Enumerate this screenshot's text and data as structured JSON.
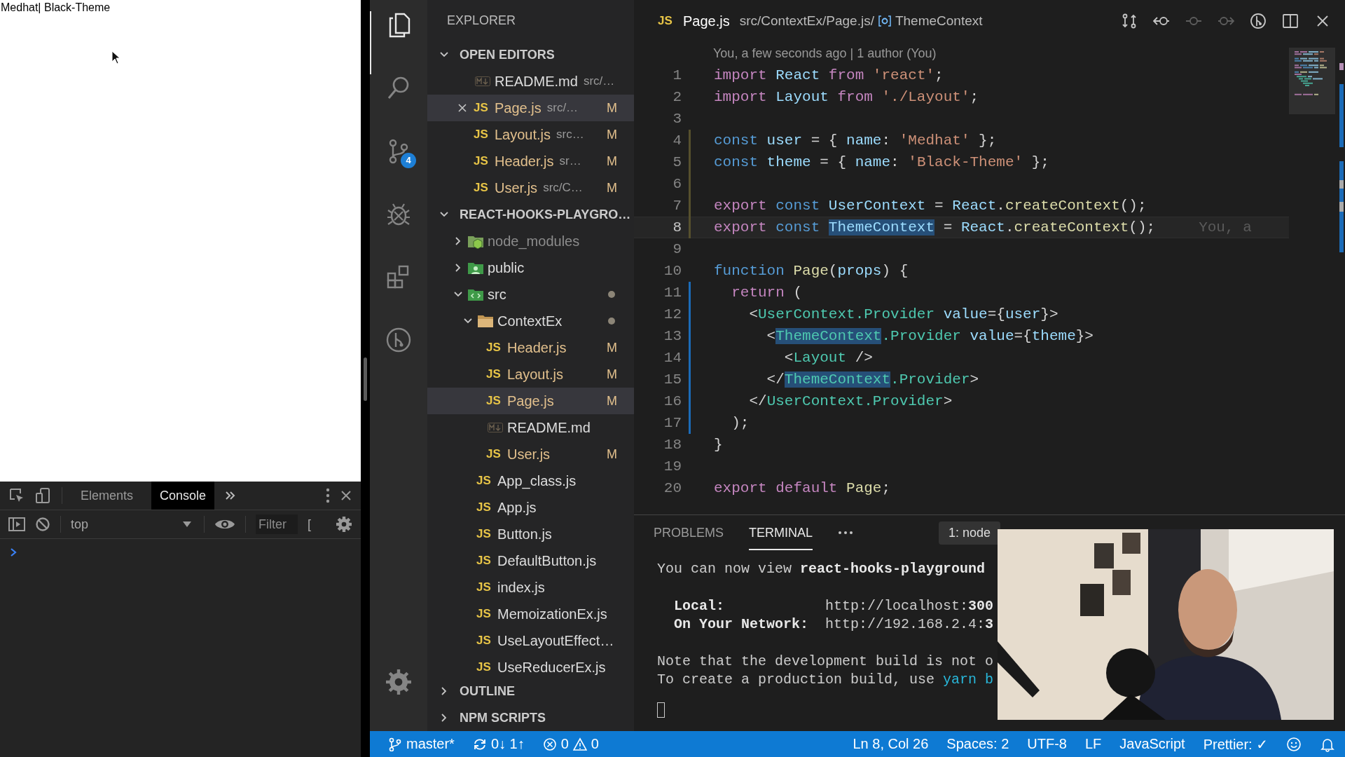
{
  "browser_page": {
    "text": "Medhat| Black-Theme"
  },
  "devtools": {
    "tabs": [
      {
        "label": "Elements",
        "selected": false
      },
      {
        "label": "Console",
        "selected": true
      }
    ],
    "context": "top",
    "filter": {
      "placeholder": "Filter"
    },
    "levels": "["
  },
  "activity_bar": [
    {
      "kind": "explorer",
      "selected": true
    },
    {
      "kind": "search",
      "selected": false
    },
    {
      "kind": "source-control",
      "selected": false,
      "badge": "4"
    },
    {
      "kind": "debug",
      "selected": false
    },
    {
      "kind": "extensions",
      "selected": false
    },
    {
      "kind": "git-graph",
      "selected": false
    }
  ],
  "explorer": {
    "title": "EXPLORER",
    "open_editors": {
      "title": "OPEN EDITORS",
      "expanded": true,
      "items": [
        {
          "name": "README.md",
          "path": "src/…",
          "kind": "md",
          "selected": false
        },
        {
          "name": "Page.js",
          "path": "src/…",
          "kind": "js",
          "icon_label": "JS",
          "status": "M",
          "selected": true
        },
        {
          "name": "Layout.js",
          "path": "src…",
          "kind": "js",
          "icon_label": "JS",
          "status": "M",
          "selected": false
        },
        {
          "name": "Header.js",
          "path": "sr…",
          "kind": "js",
          "icon_label": "JS",
          "status": "M",
          "selected": false
        },
        {
          "name": "User.js",
          "path": "src/C…",
          "kind": "js",
          "icon_label": "JS",
          "status": "M",
          "selected": false
        }
      ]
    },
    "project": {
      "title": "REACT-HOOKS-PLAYGRO…",
      "expanded": true,
      "tree": [
        {
          "name": "node_modules",
          "kind": "node-folder",
          "expanded": false,
          "ignored": true,
          "selected": false
        },
        {
          "name": "public",
          "kind": "public-folder",
          "expanded": false,
          "selected": false
        },
        {
          "name": "src",
          "kind": "src-folder",
          "expanded": true,
          "contains_changes": true,
          "selected": false,
          "children": [
            {
              "name": "ContextEx",
              "kind": "folder",
              "expanded": true,
              "contains_changes": true,
              "selected": false,
              "children": [
                {
                  "name": "Header.js",
                  "kind": "js",
                  "icon_label": "JS",
                  "status": "M",
                  "selected": false
                },
                {
                  "name": "Layout.js",
                  "kind": "js",
                  "icon_label": "JS",
                  "status": "M",
                  "selected": false
                },
                {
                  "name": "Page.js",
                  "kind": "js",
                  "icon_label": "JS",
                  "status": "M",
                  "selected": true
                },
                {
                  "name": "README.md",
                  "kind": "md",
                  "selected": false
                },
                {
                  "name": "User.js",
                  "kind": "js",
                  "icon_label": "JS",
                  "status": "M",
                  "selected": false
                }
              ]
            },
            {
              "name": "App_class.js",
              "kind": "js",
              "icon_label": "JS",
              "selected": false
            },
            {
              "name": "App.js",
              "kind": "js",
              "icon_label": "JS",
              "selected": false
            },
            {
              "name": "Button.js",
              "kind": "js",
              "icon_label": "JS",
              "selected": false
            },
            {
              "name": "DefaultButton.js",
              "kind": "js",
              "icon_label": "JS",
              "selected": false
            },
            {
              "name": "index.js",
              "kind": "js",
              "icon_label": "JS",
              "selected": false
            },
            {
              "name": "MemoizationEx.js",
              "kind": "js",
              "icon_label": "JS",
              "selected": false
            },
            {
              "name": "UseLayoutEffect…",
              "kind": "js",
              "icon_label": "JS",
              "selected": false
            },
            {
              "name": "UseReducerEx.js",
              "kind": "js",
              "icon_label": "JS",
              "selected": false
            }
          ]
        }
      ]
    },
    "sections": [
      {
        "title": "OUTLINE",
        "expanded": false
      },
      {
        "title": "NPM SCRIPTS",
        "expanded": false
      }
    ]
  },
  "editor": {
    "tab": {
      "icon_label": "JS",
      "name": "Page.js",
      "breadcrumb": "src/ContextEx/Page.js/",
      "symbol": "ThemeContext"
    },
    "actions": [
      {
        "kind": "compare",
        "disabled": false
      },
      {
        "kind": "back",
        "disabled": false
      },
      {
        "kind": "commit",
        "disabled": true
      },
      {
        "kind": "forward",
        "disabled": true
      },
      {
        "kind": "gitlens",
        "disabled": false
      },
      {
        "kind": "split",
        "disabled": false
      },
      {
        "kind": "close",
        "disabled": false
      }
    ],
    "blame": "You, a few seconds ago | 1 author (You)",
    "lines": [
      {
        "number": "1",
        "tokens": [
          {
            "text": "import",
            "kind": "kw"
          },
          {
            "text": " React",
            "kind": "var"
          },
          {
            "text": " from",
            "kind": "kw"
          },
          {
            "text": " 'react'",
            "kind": "str"
          },
          {
            "text": ";",
            "kind": "p"
          }
        ]
      },
      {
        "number": "2",
        "tokens": [
          {
            "text": "import",
            "kind": "kw"
          },
          {
            "text": " Layout",
            "kind": "var"
          },
          {
            "text": " from",
            "kind": "kw"
          },
          {
            "text": " './Layout'",
            "kind": "str"
          },
          {
            "text": ";",
            "kind": "p"
          }
        ]
      },
      {
        "number": "3"
      },
      {
        "number": "4",
        "modified": true,
        "tokens": [
          {
            "text": "const",
            "kind": "storage"
          },
          {
            "text": " user",
            "kind": "var"
          },
          {
            "text": " = { ",
            "kind": "p"
          },
          {
            "text": "name",
            "kind": "var"
          },
          {
            "text": ": ",
            "kind": "p"
          },
          {
            "text": "'Medhat'",
            "kind": "str"
          },
          {
            "text": " };",
            "kind": "p"
          }
        ]
      },
      {
        "number": "5",
        "modified": true,
        "tokens": [
          {
            "text": "const",
            "kind": "storage"
          },
          {
            "text": " theme",
            "kind": "var"
          },
          {
            "text": " = { ",
            "kind": "p"
          },
          {
            "text": "name",
            "kind": "var"
          },
          {
            "text": ": ",
            "kind": "p"
          },
          {
            "text": "'Black-Theme'",
            "kind": "str"
          },
          {
            "text": " };",
            "kind": "p"
          }
        ]
      },
      {
        "number": "6",
        "modified": true
      },
      {
        "number": "7",
        "modified": true,
        "tokens": [
          {
            "text": "export",
            "kind": "kw"
          },
          {
            "text": " const",
            "kind": "storage"
          },
          {
            "text": " UserContext",
            "kind": "var"
          },
          {
            "text": " = ",
            "kind": "p"
          },
          {
            "text": "React",
            "kind": "var"
          },
          {
            "text": ".",
            "kind": "p"
          },
          {
            "text": "createContext",
            "kind": "fn"
          },
          {
            "text": "();",
            "kind": "p"
          }
        ]
      },
      {
        "number": "8",
        "modified": true,
        "current": true,
        "hint": "You, a",
        "tokens": [
          {
            "text": "export",
            "kind": "kw"
          },
          {
            "text": " const ",
            "kind": "storage"
          },
          {
            "text": "ThemeContext",
            "kind": "var",
            "highlight": true
          },
          {
            "text": " = ",
            "kind": "p"
          },
          {
            "text": "React",
            "kind": "var"
          },
          {
            "text": ".",
            "kind": "p"
          },
          {
            "text": "createContext",
            "kind": "fn"
          },
          {
            "text": "();",
            "kind": "p"
          }
        ]
      },
      {
        "number": "9"
      },
      {
        "number": "10",
        "tokens": [
          {
            "text": "function",
            "kind": "storage"
          },
          {
            "text": " Page",
            "kind": "fn"
          },
          {
            "text": "(",
            "kind": "p"
          },
          {
            "text": "props",
            "kind": "var"
          },
          {
            "text": ") {",
            "kind": "p"
          }
        ]
      },
      {
        "number": "11",
        "added": true,
        "tokens": [
          {
            "text": "  return",
            "kind": "kw"
          },
          {
            "text": " (",
            "kind": "p"
          }
        ]
      },
      {
        "number": "12",
        "added": true,
        "tokens": [
          {
            "text": "    <",
            "kind": "p"
          },
          {
            "text": "UserContext.Provider",
            "kind": "tag"
          },
          {
            "text": " value",
            "kind": "var"
          },
          {
            "text": "={",
            "kind": "p"
          },
          {
            "text": "user",
            "kind": "var"
          },
          {
            "text": "}>",
            "kind": "p"
          }
        ]
      },
      {
        "number": "13",
        "added": true,
        "tokens": [
          {
            "text": "      <",
            "kind": "p"
          },
          {
            "text": "ThemeContext",
            "kind": "tag",
            "highlight": true
          },
          {
            "text": ".Provider",
            "kind": "tag"
          },
          {
            "text": " value",
            "kind": "var"
          },
          {
            "text": "={",
            "kind": "p"
          },
          {
            "text": "theme",
            "kind": "var"
          },
          {
            "text": "}>",
            "kind": "p"
          }
        ]
      },
      {
        "number": "14",
        "added": true,
        "tokens": [
          {
            "text": "        <",
            "kind": "p"
          },
          {
            "text": "Layout",
            "kind": "tag"
          },
          {
            "text": " />",
            "kind": "p"
          }
        ]
      },
      {
        "number": "15",
        "added": true,
        "tokens": [
          {
            "text": "      </",
            "kind": "p"
          },
          {
            "text": "ThemeContext",
            "kind": "tag",
            "highlight": true
          },
          {
            "text": ".Provider",
            "kind": "tag"
          },
          {
            "text": ">",
            "kind": "p"
          }
        ]
      },
      {
        "number": "16",
        "added": true,
        "tokens": [
          {
            "text": "    </",
            "kind": "p"
          },
          {
            "text": "UserContext.Provider",
            "kind": "tag"
          },
          {
            "text": ">",
            "kind": "p"
          }
        ]
      },
      {
        "number": "17",
        "added": true,
        "tokens": [
          {
            "text": "  );",
            "kind": "p"
          }
        ]
      },
      {
        "number": "18",
        "tokens": [
          {
            "text": "}",
            "kind": "p"
          }
        ]
      },
      {
        "number": "19"
      },
      {
        "number": "20",
        "tokens": [
          {
            "text": "export",
            "kind": "kw"
          },
          {
            "text": " default",
            "kind": "kw"
          },
          {
            "text": " Page",
            "kind": "fn"
          },
          {
            "text": ";",
            "kind": "p"
          }
        ]
      }
    ]
  },
  "panel": {
    "tabs": [
      {
        "label": "PROBLEMS",
        "selected": false
      },
      {
        "label": "TERMINAL",
        "selected": true
      }
    ],
    "terminal_select": "1: node",
    "output": [
      [
        [
          {
            "text": "You can now view ",
            "kind": "plain"
          },
          {
            "text": "react-hooks-playground",
            "kind": "bold"
          }
        ]
      ],
      [
        [
          {
            "text": "  Local:",
            "kind": "bold"
          },
          {
            "text": "            http://localhost:",
            "kind": "plain"
          },
          {
            "text": "300",
            "kind": "bold"
          }
        ],
        [
          {
            "text": "  On Your Network:",
            "kind": "bold"
          },
          {
            "text": "  http://192.168.2.4:",
            "kind": "plain"
          },
          {
            "text": "3",
            "kind": "bold"
          }
        ]
      ],
      [
        [
          {
            "text": "Note that the development build is not o",
            "kind": "plain"
          }
        ],
        [
          {
            "text": "To create a production build, use ",
            "kind": "plain"
          },
          {
            "text": "yarn b",
            "kind": "command"
          }
        ]
      ]
    ],
    "webcam": {
      "kind": "picture"
    }
  },
  "status_bar": {
    "branch": "master*",
    "sync": "0↓ 1↑",
    "errors": "0",
    "warnings": "0",
    "right": [
      "Ln 8, Col 26",
      "Spaces: 2",
      "UTF-8",
      "LF",
      "JavaScript",
      "Prettier: ✓"
    ]
  }
}
